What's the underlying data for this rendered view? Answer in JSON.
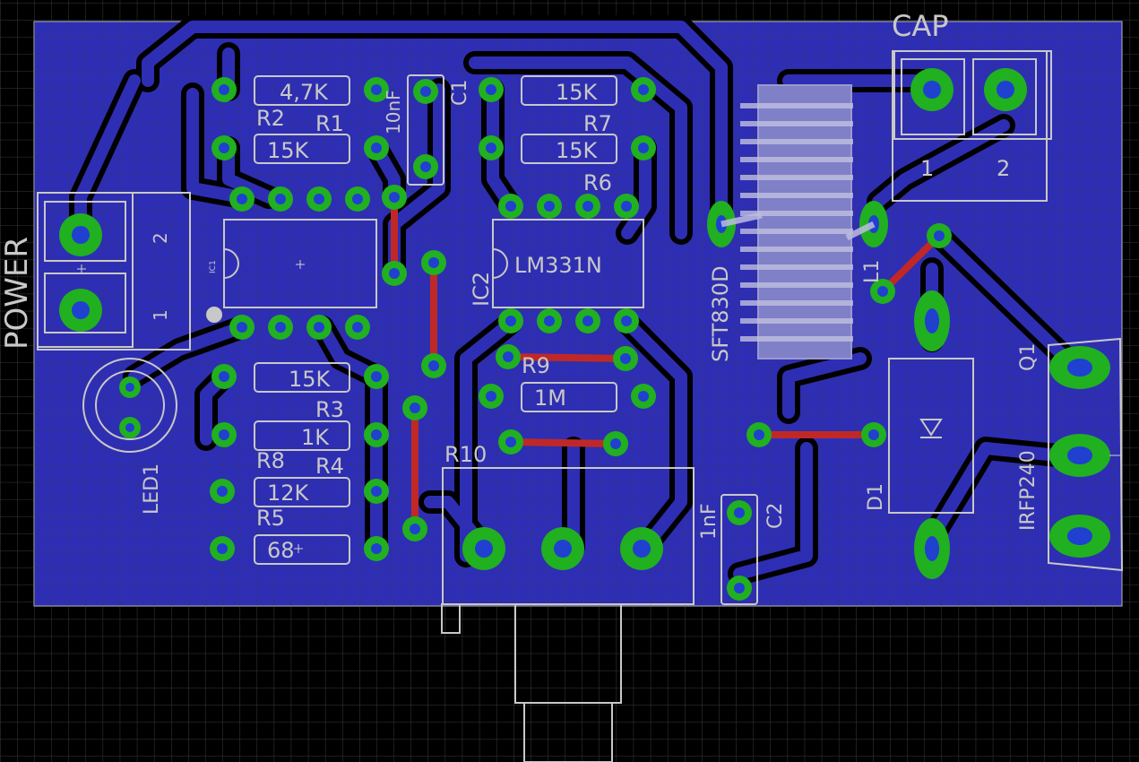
{
  "colors": {
    "background": "#000000",
    "grid": "#3a3a3a",
    "board": "#2e2eb4",
    "trace_top": "#c02828",
    "pad": "#20b020",
    "drill": "#2040d0",
    "silkscreen": "#c8c8c8",
    "keepout": "#000000"
  },
  "connectors": {
    "cap_title": "CAP",
    "cap_pin1": "1",
    "cap_pin2": "2",
    "power_title": "POWER",
    "power_pin1": "1",
    "power_pin2": "2"
  },
  "resistors": {
    "r1_value": "4,7K",
    "r1_name": "R1",
    "r2_value": "15K",
    "r2_name": "R2",
    "r7_value": "15K",
    "r7_name": "R7",
    "r6_value": "15K",
    "r6_name": "R6",
    "r3_value": "15K",
    "r3_name": "R3",
    "r4_value": "1K",
    "r4_name": "R4",
    "r8_value": "12K",
    "r8_name": "R8",
    "r5_value": "68",
    "r5_name": "R5",
    "r9_value": "1M",
    "r9_name": "R9",
    "r10_name": "R10"
  },
  "capacitors": {
    "c1_value": "10nF",
    "c1_name": "C1",
    "c2_value": "1nF",
    "c2_name": "C2"
  },
  "ics": {
    "ic1_name": "IC1",
    "ic2_name": "IC2",
    "ic2_part": "LM331N"
  },
  "misc": {
    "led1_name": "LED1",
    "transformer_name": "SFT830D",
    "inductor_name": "L1",
    "diode_name": "D1",
    "q1_name": "Q1",
    "q1_part": "IRFP240"
  }
}
